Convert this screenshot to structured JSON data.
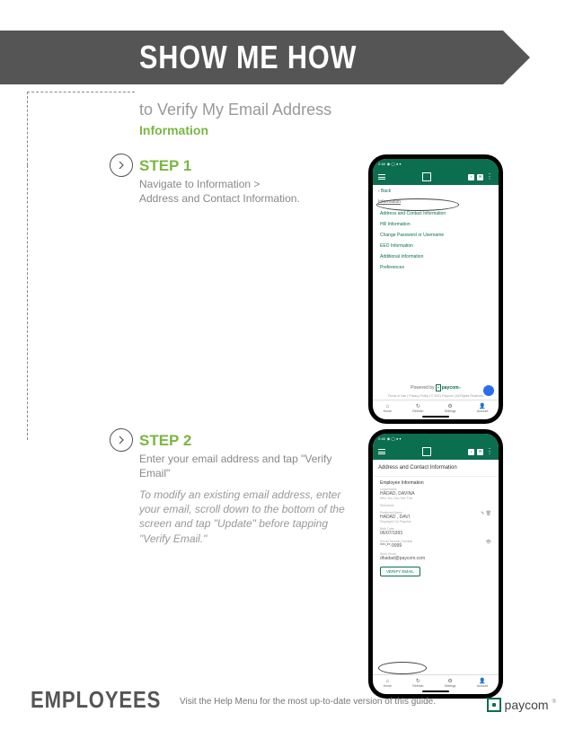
{
  "banner": {
    "title": "SHOW ME HOW"
  },
  "subtitle": "to Verify My Email Address",
  "category": "Information",
  "steps": {
    "s1": {
      "label": "STEP 1",
      "desc": "Navigate to Information >\nAddress and Contact Information."
    },
    "s2": {
      "label": "STEP 2",
      "desc": "Enter your email address and tap \"Verify Email\"",
      "note": "To modify an existing email address, enter your email, scroll down to the bottom of the screen and tap \"Update\" before tapping \"Verify Email.\""
    }
  },
  "phone1": {
    "time": "2:48",
    "back": "‹  Back",
    "section": "Information",
    "items": {
      "i0": "Address and Contact Information",
      "i1": "HR Information",
      "i2": "Change Password or Username",
      "i3": "EEO Information",
      "i4": "Additional Information",
      "i5": "Preferences"
    },
    "powered_pre": "Powered by ",
    "powered_brand": "paycom",
    "terms": "Terms of Use | Privacy Policy | © 2021 Paycom | All Rights Reserved",
    "nav": {
      "n0": "Home",
      "n1": "Refresh",
      "n2": "Settings",
      "n3": "Account"
    }
  },
  "phone2": {
    "time": "2:48",
    "title": "Address and Contact Information",
    "section": "Employee Information",
    "legal_name_label": "Legal Name",
    "legal_name": "HADAD, DAVINA",
    "see_label": "Who You Can See This",
    "nickname_label": "Nickname",
    "preferred_label": "Preferred Name",
    "preferred": "HADAD , DAVI",
    "displayed_label": "Displayed On Paystub",
    "birth_label": "Birth Date",
    "birth": "06/07/1993",
    "ssn_label": "Social Security Number",
    "ssn": "***-**-9999",
    "work_email_label": "Work Email",
    "work_email": "dhadad@paycom.com",
    "verify": "VERIFY EMAIL",
    "nav": {
      "n0": "Home",
      "n1": "Refresh",
      "n2": "Settings",
      "n3": "Account"
    }
  },
  "footer": {
    "audience": "EMPLOYEES",
    "note": "Visit the Help Menu for the most up-to-date version of this guide.",
    "brand": "paycom",
    "reg": "®"
  }
}
